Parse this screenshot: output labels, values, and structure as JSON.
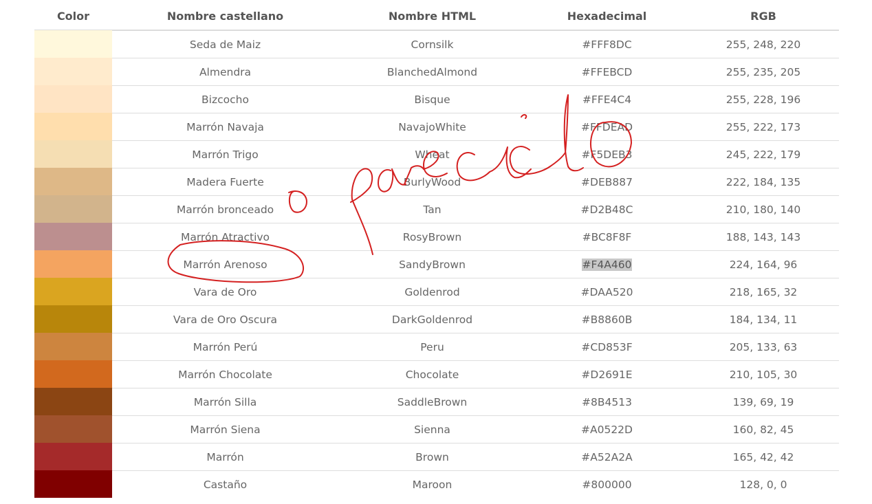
{
  "headers": {
    "color": "Color",
    "name_es": "Nombre castellano",
    "name_html": "Nombre HTML",
    "hex": "Hexadecimal",
    "rgb": "RGB"
  },
  "rows": [
    {
      "swatch": "#FFF8DC",
      "name_es": "Seda de Maiz",
      "name_html": "Cornsilk",
      "hex": "#FFF8DC",
      "rgb": "255, 248, 220"
    },
    {
      "swatch": "#FFEBCD",
      "name_es": "Almendra",
      "name_html": "BlanchedAlmond",
      "hex": "#FFEBCD",
      "rgb": "255, 235, 205"
    },
    {
      "swatch": "#FFE4C4",
      "name_es": "Bizcocho",
      "name_html": "Bisque",
      "hex": "#FFE4C4",
      "rgb": "255, 228, 196"
    },
    {
      "swatch": "#FFDEAD",
      "name_es": "Marrón Navaja",
      "name_html": "NavajoWhite",
      "hex": "#FFDEAD",
      "rgb": "255, 222, 173"
    },
    {
      "swatch": "#F5DEB3",
      "name_es": "Marrón Trigo",
      "name_html": "Wheat",
      "hex": "#F5DEB3",
      "rgb": "245, 222, 179"
    },
    {
      "swatch": "#DEB887",
      "name_es": "Madera Fuerte",
      "name_html": "BurlyWood",
      "hex": "#DEB887",
      "rgb": "222, 184, 135"
    },
    {
      "swatch": "#D2B48C",
      "name_es": "Marrón bronceado",
      "name_html": "Tan",
      "hex": "#D2B48C",
      "rgb": "210, 180, 140"
    },
    {
      "swatch": "#BC8F8F",
      "name_es": "Marrón Atractivo",
      "name_html": "RosyBrown",
      "hex": "#BC8F8F",
      "rgb": "188, 143, 143"
    },
    {
      "swatch": "#F4A460",
      "name_es": "Marrón Arenoso",
      "name_html": "SandyBrown",
      "hex": "#F4A460",
      "rgb": "224, 164, 96",
      "selected": true
    },
    {
      "swatch": "#DAA520",
      "name_es": "Vara de Oro",
      "name_html": "Goldenrod",
      "hex": "#DAA520",
      "rgb": "218, 165, 32"
    },
    {
      "swatch": "#B8860B",
      "name_es": "Vara de Oro Oscura",
      "name_html": "DarkGoldenrod",
      "hex": "#B8860B",
      "rgb": "184, 134, 11"
    },
    {
      "swatch": "#CD853F",
      "name_es": "Marrón Perú",
      "name_html": "Peru",
      "hex": "#CD853F",
      "rgb": "205, 133, 63"
    },
    {
      "swatch": "#D2691E",
      "name_es": "Marrón Chocolate",
      "name_html": "Chocolate",
      "hex": "#D2691E",
      "rgb": "210, 105, 30"
    },
    {
      "swatch": "#8B4513",
      "name_es": "Marrón Silla",
      "name_html": "SaddleBrown",
      "hex": "#8B4513",
      "rgb": "139, 69, 19"
    },
    {
      "swatch": "#A0522D",
      "name_es": "Marrón Siena",
      "name_html": "Sienna",
      "hex": "#A0522D",
      "rgb": "160, 82, 45"
    },
    {
      "swatch": "#A52A2A",
      "name_es": "Marrón",
      "name_html": "Brown",
      "hex": "#A52A2A",
      "rgb": "165, 42, 42"
    },
    {
      "swatch": "#800000",
      "name_es": "Castaño",
      "name_html": "Maroon",
      "hex": "#800000",
      "rgb": "128, 0, 0"
    }
  ],
  "annotation": {
    "text": "o parecido",
    "ink_color": "#D42020"
  }
}
